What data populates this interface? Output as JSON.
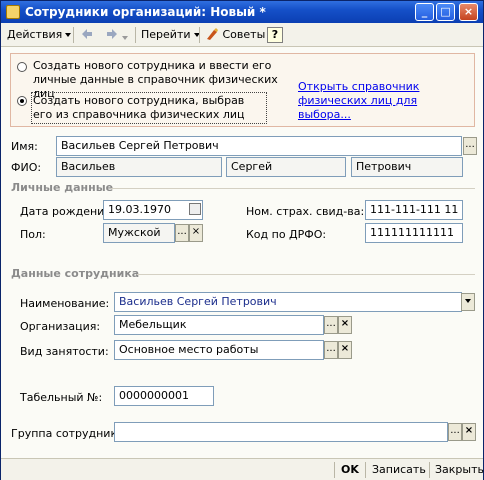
{
  "window": {
    "title": "Сотрудники организаций: Новый *"
  },
  "toolbar": {
    "actions": "Действия",
    "goto": "Перейти",
    "tips": "Советы",
    "help": "?"
  },
  "mode": {
    "option1": "Создать нового сотрудника и ввести его личные данные в справочник физических лиц",
    "option2": "Создать нового сотрудника, выбрав его из справочника физических лиц",
    "selected": "option2",
    "open_link": "Открыть справочник физических лиц для выбора..."
  },
  "person": {
    "name_label": "Имя:",
    "name_value": "Васильев Сергей Петрович",
    "fio_label": "ФИО:",
    "last_name": "Васильев",
    "first_name": "Сергей",
    "middle_name": "Петрович"
  },
  "personal": {
    "section_title": "Личные данные",
    "dob_label": "Дата рождения:",
    "dob_value": "19.03.1970",
    "gender_label": "Пол:",
    "gender_value": "Мужской",
    "snils_label": "Ном. страх. свид-ва:",
    "snils_value": "111-111-111 11",
    "drfo_label": "Код по ДРФО:",
    "drfo_value": "111111111111"
  },
  "employee": {
    "section_title": "Данные сотрудника",
    "name_label": "Наименование:",
    "name_value": "Васильев Сергей Петрович",
    "org_label": "Организация:",
    "org_value": "Мебельщик",
    "employment_label": "Вид занятости:",
    "employment_value": "Основное место работы",
    "tab_label": "Табельный №:",
    "tab_value": "0000000001",
    "group_label": "Группа сотрудника:",
    "group_value": ""
  },
  "footer": {
    "ok": "OK",
    "save": "Записать",
    "close": "Закрыть"
  }
}
